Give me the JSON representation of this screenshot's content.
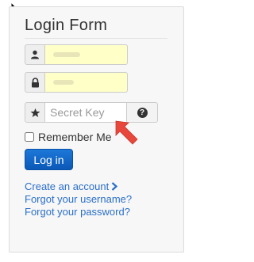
{
  "form": {
    "title": "Login Form",
    "username_icon": "user-icon",
    "password_icon": "lock-icon",
    "secret_icon": "star-icon",
    "secret_placeholder": "Secret Key",
    "help_icon": "question-circle-icon",
    "remember_label": "Remember Me",
    "remember_checked": false,
    "login_label": "Log in"
  },
  "links": {
    "create_account": "Create an account",
    "forgot_username": "Forgot your username?",
    "forgot_password": "Forgot your password?"
  },
  "colors": {
    "autofill": "#ffffc8",
    "primary_button": "#1565c7",
    "link": "#2a6fc9",
    "annotation_arrow": "#e8473c"
  }
}
